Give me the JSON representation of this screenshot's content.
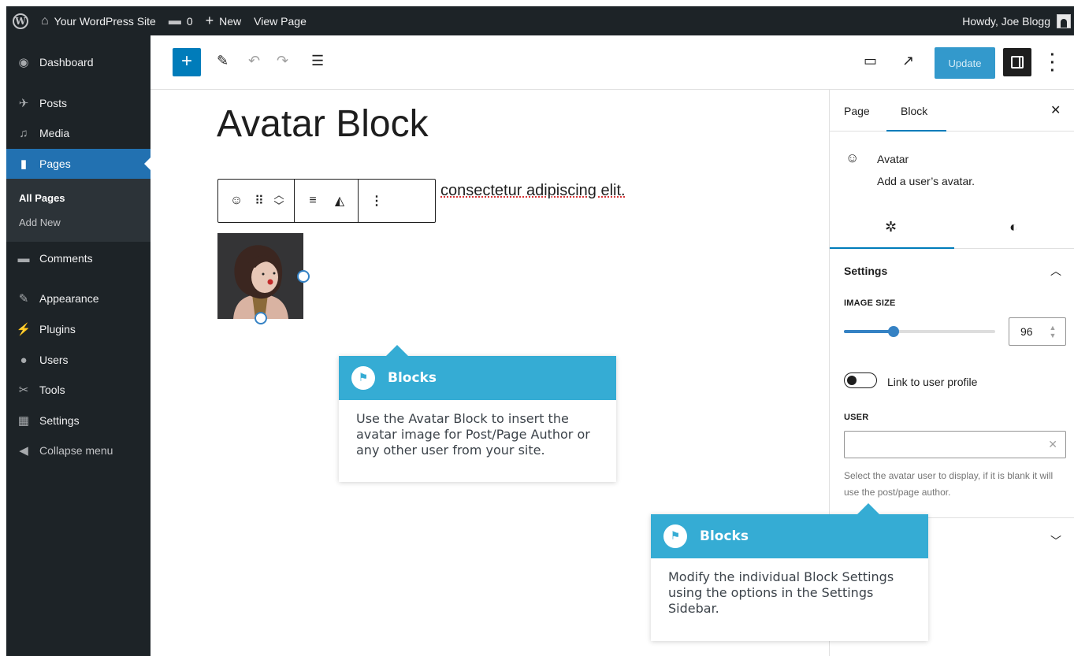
{
  "admin_bar": {
    "site_name": "Your WordPress Site",
    "comments_count": "0",
    "new_label": "New",
    "view_page_label": "View Page",
    "howdy": "Howdy, Joe Blogg"
  },
  "admin_menu": {
    "items": [
      {
        "label": "Dashboard",
        "icon": "dashboard-icon"
      },
      {
        "label": "Posts",
        "icon": "pin-icon"
      },
      {
        "label": "Media",
        "icon": "media-icon"
      },
      {
        "label": "Pages",
        "icon": "pages-icon"
      },
      {
        "label": "Comments",
        "icon": "comment-icon"
      },
      {
        "label": "Appearance",
        "icon": "brush-icon"
      },
      {
        "label": "Plugins",
        "icon": "plug-icon"
      },
      {
        "label": "Users",
        "icon": "user-icon"
      },
      {
        "label": "Tools",
        "icon": "wrench-icon"
      },
      {
        "label": "Settings",
        "icon": "settings-icon"
      },
      {
        "label": "Collapse menu",
        "icon": "collapse-icon"
      }
    ],
    "submenu": [
      "All Pages",
      "Add New"
    ]
  },
  "editor": {
    "page_title": "Avatar Block",
    "paragraph_text": "consectetur adipiscing elit.",
    "update_label": "Update"
  },
  "callouts": [
    {
      "title": "Blocks",
      "body": "Use the Avatar Block to insert the avatar image for Post/Page Author or any other user from your site."
    },
    {
      "title": "Blocks",
      "body": "Modify the individual Block Settings using the options in the Settings Sidebar."
    }
  ],
  "sidebar": {
    "tabs": [
      "Page",
      "Block"
    ],
    "active_tab": "Block",
    "block_title": "Avatar",
    "block_description": "Add a user’s avatar.",
    "settings_title": "Settings",
    "image_size_label": "IMAGE SIZE",
    "image_size_value": "96",
    "image_size_fraction": 0.33,
    "link_label": "Link to user profile",
    "link_enabled": false,
    "user_label": "USER",
    "user_value": "",
    "help_text": "Select the avatar user to display, if it is blank it will use the post/page author."
  },
  "colors": {
    "admin_dark": "#1d2327",
    "accent_blue": "#007cba",
    "menu_active": "#2271b1",
    "callout_blue": "#35acd4"
  }
}
